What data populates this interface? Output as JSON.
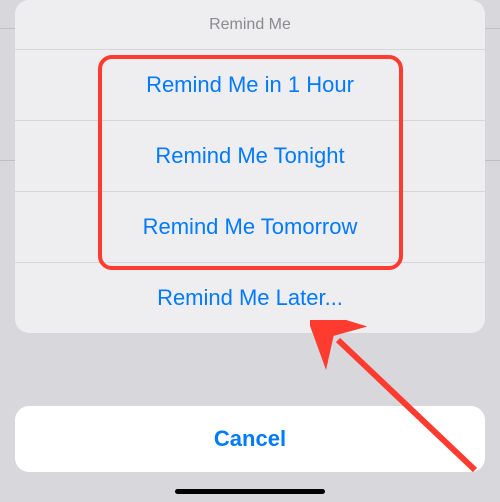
{
  "sheet": {
    "title": "Remind Me",
    "options": [
      "Remind Me in 1 Hour",
      "Remind Me Tonight",
      "Remind Me Tomorrow",
      "Remind Me Later..."
    ]
  },
  "cancel": "Cancel"
}
